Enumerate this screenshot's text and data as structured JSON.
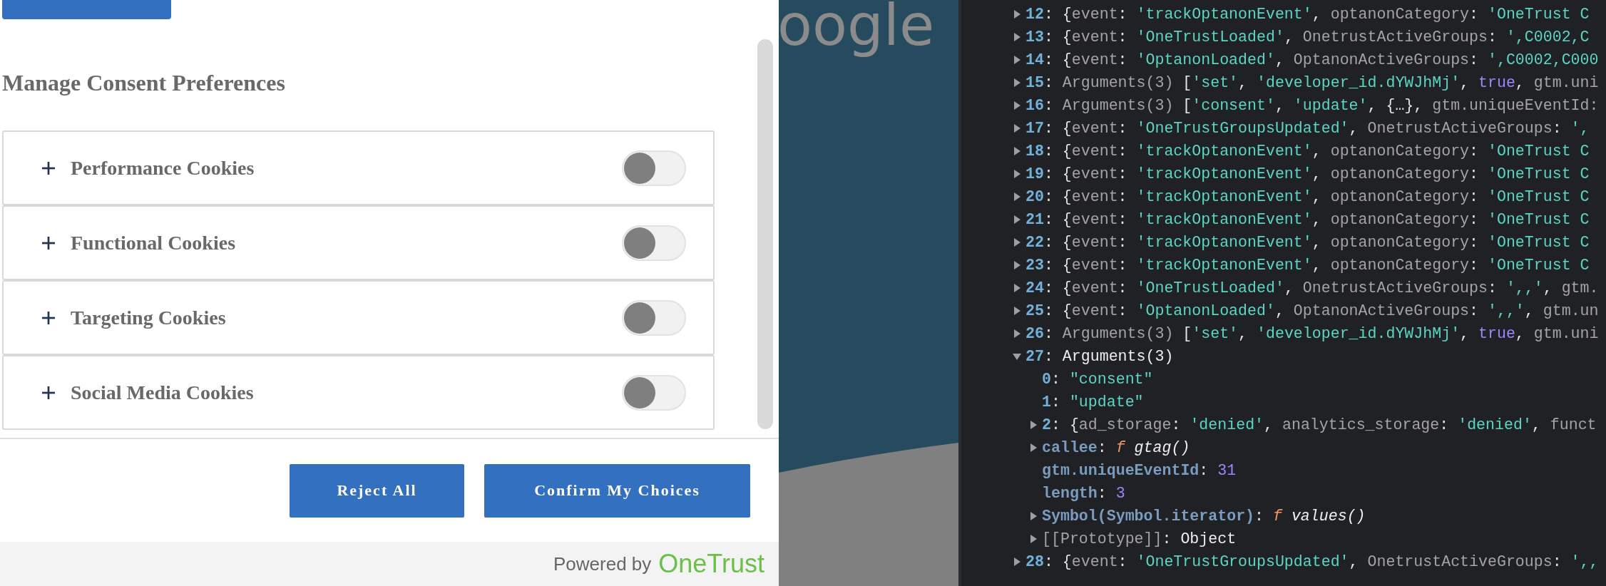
{
  "consent": {
    "heading": "Manage Consent Preferences",
    "categories": [
      {
        "label": "Performance Cookies",
        "expanded": false,
        "on": false
      },
      {
        "label": "Functional Cookies",
        "expanded": false,
        "on": false
      },
      {
        "label": "Targeting Cookies",
        "expanded": false,
        "on": false
      },
      {
        "label": "Social Media Cookies",
        "expanded": false,
        "on": false
      }
    ],
    "buttons": [
      {
        "label": "Reject All"
      },
      {
        "label": "Confirm My Choices"
      }
    ],
    "footer": {
      "prefix": "Powered by",
      "brand": "OneTrust"
    }
  },
  "backdrop": {
    "logo_text": "oogle"
  },
  "console": {
    "rows": [
      {
        "expanded": false,
        "segments": [
          {
            "kind": "index",
            "text": "12"
          },
          {
            "kind": "punct",
            "text": ": {"
          },
          {
            "kind": "name",
            "text": "event"
          },
          {
            "kind": "punct",
            "text": ": "
          },
          {
            "kind": "string",
            "text": "'trackOptanonEvent'"
          },
          {
            "kind": "punct",
            "text": ", "
          },
          {
            "kind": "name",
            "text": "optanonCategory"
          },
          {
            "kind": "punct",
            "text": ": "
          },
          {
            "kind": "string",
            "text": "'OneTrust C"
          }
        ]
      },
      {
        "expanded": false,
        "segments": [
          {
            "kind": "index",
            "text": "13"
          },
          {
            "kind": "punct",
            "text": ": {"
          },
          {
            "kind": "name",
            "text": "event"
          },
          {
            "kind": "punct",
            "text": ": "
          },
          {
            "kind": "string",
            "text": "'OneTrustLoaded'"
          },
          {
            "kind": "punct",
            "text": ", "
          },
          {
            "kind": "name",
            "text": "OnetrustActiveGroups"
          },
          {
            "kind": "punct",
            "text": ": "
          },
          {
            "kind": "string",
            "text": "',C0002,C"
          }
        ]
      },
      {
        "expanded": false,
        "segments": [
          {
            "kind": "index",
            "text": "14"
          },
          {
            "kind": "punct",
            "text": ": {"
          },
          {
            "kind": "name",
            "text": "event"
          },
          {
            "kind": "punct",
            "text": ": "
          },
          {
            "kind": "string",
            "text": "'OptanonLoaded'"
          },
          {
            "kind": "punct",
            "text": ", "
          },
          {
            "kind": "name",
            "text": "OptanonActiveGroups"
          },
          {
            "kind": "punct",
            "text": ": "
          },
          {
            "kind": "string",
            "text": "',C0002,C000"
          }
        ]
      },
      {
        "expanded": false,
        "segments": [
          {
            "kind": "index",
            "text": "15"
          },
          {
            "kind": "punct",
            "text": ": "
          },
          {
            "kind": "name",
            "text": "Arguments(3) "
          },
          {
            "kind": "punct",
            "text": "["
          },
          {
            "kind": "string",
            "text": "'set'"
          },
          {
            "kind": "punct",
            "text": ", "
          },
          {
            "kind": "string",
            "text": "'developer_id.dYWJhMj'"
          },
          {
            "kind": "punct",
            "text": ", "
          },
          {
            "kind": "literal",
            "text": "true"
          },
          {
            "kind": "punct",
            "text": ", "
          },
          {
            "kind": "name",
            "text": "gtm.uni"
          }
        ]
      },
      {
        "expanded": false,
        "segments": [
          {
            "kind": "index",
            "text": "16"
          },
          {
            "kind": "punct",
            "text": ": "
          },
          {
            "kind": "name",
            "text": "Arguments(3) "
          },
          {
            "kind": "punct",
            "text": "["
          },
          {
            "kind": "string",
            "text": "'consent'"
          },
          {
            "kind": "punct",
            "text": ", "
          },
          {
            "kind": "string",
            "text": "'update'"
          },
          {
            "kind": "punct",
            "text": ", {…}, "
          },
          {
            "kind": "name",
            "text": "gtm.uniqueEventId:"
          }
        ]
      },
      {
        "expanded": false,
        "segments": [
          {
            "kind": "index",
            "text": "17"
          },
          {
            "kind": "punct",
            "text": ": {"
          },
          {
            "kind": "name",
            "text": "event"
          },
          {
            "kind": "punct",
            "text": ": "
          },
          {
            "kind": "string",
            "text": "'OneTrustGroupsUpdated'"
          },
          {
            "kind": "punct",
            "text": ", "
          },
          {
            "kind": "name",
            "text": "OnetrustActiveGroups"
          },
          {
            "kind": "punct",
            "text": ": "
          },
          {
            "kind": "string",
            "text": "',"
          }
        ]
      },
      {
        "expanded": false,
        "segments": [
          {
            "kind": "index",
            "text": "18"
          },
          {
            "kind": "punct",
            "text": ": {"
          },
          {
            "kind": "name",
            "text": "event"
          },
          {
            "kind": "punct",
            "text": ": "
          },
          {
            "kind": "string",
            "text": "'trackOptanonEvent'"
          },
          {
            "kind": "punct",
            "text": ", "
          },
          {
            "kind": "name",
            "text": "optanonCategory"
          },
          {
            "kind": "punct",
            "text": ": "
          },
          {
            "kind": "string",
            "text": "'OneTrust C"
          }
        ]
      },
      {
        "expanded": false,
        "segments": [
          {
            "kind": "index",
            "text": "19"
          },
          {
            "kind": "punct",
            "text": ": {"
          },
          {
            "kind": "name",
            "text": "event"
          },
          {
            "kind": "punct",
            "text": ": "
          },
          {
            "kind": "string",
            "text": "'trackOptanonEvent'"
          },
          {
            "kind": "punct",
            "text": ", "
          },
          {
            "kind": "name",
            "text": "optanonCategory"
          },
          {
            "kind": "punct",
            "text": ": "
          },
          {
            "kind": "string",
            "text": "'OneTrust C"
          }
        ]
      },
      {
        "expanded": false,
        "segments": [
          {
            "kind": "index",
            "text": "20"
          },
          {
            "kind": "punct",
            "text": ": {"
          },
          {
            "kind": "name",
            "text": "event"
          },
          {
            "kind": "punct",
            "text": ": "
          },
          {
            "kind": "string",
            "text": "'trackOptanonEvent'"
          },
          {
            "kind": "punct",
            "text": ", "
          },
          {
            "kind": "name",
            "text": "optanonCategory"
          },
          {
            "kind": "punct",
            "text": ": "
          },
          {
            "kind": "string",
            "text": "'OneTrust C"
          }
        ]
      },
      {
        "expanded": false,
        "segments": [
          {
            "kind": "index",
            "text": "21"
          },
          {
            "kind": "punct",
            "text": ": {"
          },
          {
            "kind": "name",
            "text": "event"
          },
          {
            "kind": "punct",
            "text": ": "
          },
          {
            "kind": "string",
            "text": "'trackOptanonEvent'"
          },
          {
            "kind": "punct",
            "text": ", "
          },
          {
            "kind": "name",
            "text": "optanonCategory"
          },
          {
            "kind": "punct",
            "text": ": "
          },
          {
            "kind": "string",
            "text": "'OneTrust C"
          }
        ]
      },
      {
        "expanded": false,
        "segments": [
          {
            "kind": "index",
            "text": "22"
          },
          {
            "kind": "punct",
            "text": ": {"
          },
          {
            "kind": "name",
            "text": "event"
          },
          {
            "kind": "punct",
            "text": ": "
          },
          {
            "kind": "string",
            "text": "'trackOptanonEvent'"
          },
          {
            "kind": "punct",
            "text": ", "
          },
          {
            "kind": "name",
            "text": "optanonCategory"
          },
          {
            "kind": "punct",
            "text": ": "
          },
          {
            "kind": "string",
            "text": "'OneTrust C"
          }
        ]
      },
      {
        "expanded": false,
        "segments": [
          {
            "kind": "index",
            "text": "23"
          },
          {
            "kind": "punct",
            "text": ": {"
          },
          {
            "kind": "name",
            "text": "event"
          },
          {
            "kind": "punct",
            "text": ": "
          },
          {
            "kind": "string",
            "text": "'trackOptanonEvent'"
          },
          {
            "kind": "punct",
            "text": ", "
          },
          {
            "kind": "name",
            "text": "optanonCategory"
          },
          {
            "kind": "punct",
            "text": ": "
          },
          {
            "kind": "string",
            "text": "'OneTrust C"
          }
        ]
      },
      {
        "expanded": false,
        "segments": [
          {
            "kind": "index",
            "text": "24"
          },
          {
            "kind": "punct",
            "text": ": {"
          },
          {
            "kind": "name",
            "text": "event"
          },
          {
            "kind": "punct",
            "text": ": "
          },
          {
            "kind": "string",
            "text": "'OneTrustLoaded'"
          },
          {
            "kind": "punct",
            "text": ", "
          },
          {
            "kind": "name",
            "text": "OnetrustActiveGroups"
          },
          {
            "kind": "punct",
            "text": ": "
          },
          {
            "kind": "string",
            "text": "',,'"
          },
          {
            "kind": "punct",
            "text": ", "
          },
          {
            "kind": "name",
            "text": "gtm."
          }
        ]
      },
      {
        "expanded": false,
        "segments": [
          {
            "kind": "index",
            "text": "25"
          },
          {
            "kind": "punct",
            "text": ": {"
          },
          {
            "kind": "name",
            "text": "event"
          },
          {
            "kind": "punct",
            "text": ": "
          },
          {
            "kind": "string",
            "text": "'OptanonLoaded'"
          },
          {
            "kind": "punct",
            "text": ", "
          },
          {
            "kind": "name",
            "text": "OptanonActiveGroups"
          },
          {
            "kind": "punct",
            "text": ": "
          },
          {
            "kind": "string",
            "text": "',,'"
          },
          {
            "kind": "punct",
            "text": ", "
          },
          {
            "kind": "name",
            "text": "gtm.un"
          }
        ]
      },
      {
        "expanded": false,
        "segments": [
          {
            "kind": "index",
            "text": "26"
          },
          {
            "kind": "punct",
            "text": ": "
          },
          {
            "kind": "name",
            "text": "Arguments(3) "
          },
          {
            "kind": "punct",
            "text": "["
          },
          {
            "kind": "string",
            "text": "'set'"
          },
          {
            "kind": "punct",
            "text": ", "
          },
          {
            "kind": "string",
            "text": "'developer_id.dYWJhMj'"
          },
          {
            "kind": "punct",
            "text": ", "
          },
          {
            "kind": "literal",
            "text": "true"
          },
          {
            "kind": "punct",
            "text": ", "
          },
          {
            "kind": "name",
            "text": "gtm.uni"
          }
        ]
      },
      {
        "expanded": true,
        "segments": [
          {
            "kind": "index",
            "text": "27"
          },
          {
            "kind": "punct",
            "text": ": "
          },
          {
            "kind": "text",
            "text": "Arguments(3)"
          }
        ],
        "children": [
          {
            "segments": [
              {
                "kind": "index",
                "text": "0"
              },
              {
                "kind": "punct",
                "text": ": "
              },
              {
                "kind": "string",
                "text": "\"consent\""
              }
            ]
          },
          {
            "segments": [
              {
                "kind": "index",
                "text": "1"
              },
              {
                "kind": "punct",
                "text": ": "
              },
              {
                "kind": "string",
                "text": "\"update\""
              }
            ]
          },
          {
            "expanded": false,
            "segments": [
              {
                "kind": "index",
                "text": "2"
              },
              {
                "kind": "punct",
                "text": ": {"
              },
              {
                "kind": "name",
                "text": "ad_storage"
              },
              {
                "kind": "punct",
                "text": ": "
              },
              {
                "kind": "string",
                "text": "'denied'"
              },
              {
                "kind": "punct",
                "text": ", "
              },
              {
                "kind": "name",
                "text": "analytics_storage"
              },
              {
                "kind": "punct",
                "text": ": "
              },
              {
                "kind": "string",
                "text": "'denied'"
              },
              {
                "kind": "punct",
                "text": ", "
              },
              {
                "kind": "name",
                "text": "funct"
              }
            ]
          },
          {
            "expanded": false,
            "segments": [
              {
                "kind": "prop",
                "text": "callee"
              },
              {
                "kind": "punct",
                "text": ": "
              },
              {
                "kind": "func",
                "text": "f"
              },
              {
                "kind": "call",
                "text": " gtag()"
              }
            ]
          },
          {
            "segments": [
              {
                "kind": "prop",
                "text": "gtm.uniqueEventId"
              },
              {
                "kind": "punct",
                "text": ": "
              },
              {
                "kind": "literal",
                "text": "31"
              }
            ]
          },
          {
            "segments": [
              {
                "kind": "prop",
                "text": "length"
              },
              {
                "kind": "punct",
                "text": ": "
              },
              {
                "kind": "literal",
                "text": "3"
              }
            ]
          },
          {
            "expanded": false,
            "segments": [
              {
                "kind": "prop",
                "text": "Symbol(Symbol.iterator)"
              },
              {
                "kind": "punct",
                "text": ": "
              },
              {
                "kind": "func",
                "text": "f"
              },
              {
                "kind": "call",
                "text": " values()"
              }
            ]
          },
          {
            "expanded": false,
            "segments": [
              {
                "kind": "name",
                "text": "[[Prototype]]"
              },
              {
                "kind": "punct",
                "text": ": "
              },
              {
                "kind": "text",
                "text": "Object"
              }
            ]
          }
        ]
      },
      {
        "expanded": false,
        "segments": [
          {
            "kind": "index",
            "text": "28"
          },
          {
            "kind": "punct",
            "text": ": {"
          },
          {
            "kind": "name",
            "text": "event"
          },
          {
            "kind": "punct",
            "text": ": "
          },
          {
            "kind": "string",
            "text": "'OneTrustGroupsUpdated'"
          },
          {
            "kind": "punct",
            "text": ", "
          },
          {
            "kind": "name",
            "text": "OnetrustActiveGroups"
          },
          {
            "kind": "punct",
            "text": ": "
          },
          {
            "kind": "string",
            "text": "',,"
          }
        ]
      }
    ]
  }
}
